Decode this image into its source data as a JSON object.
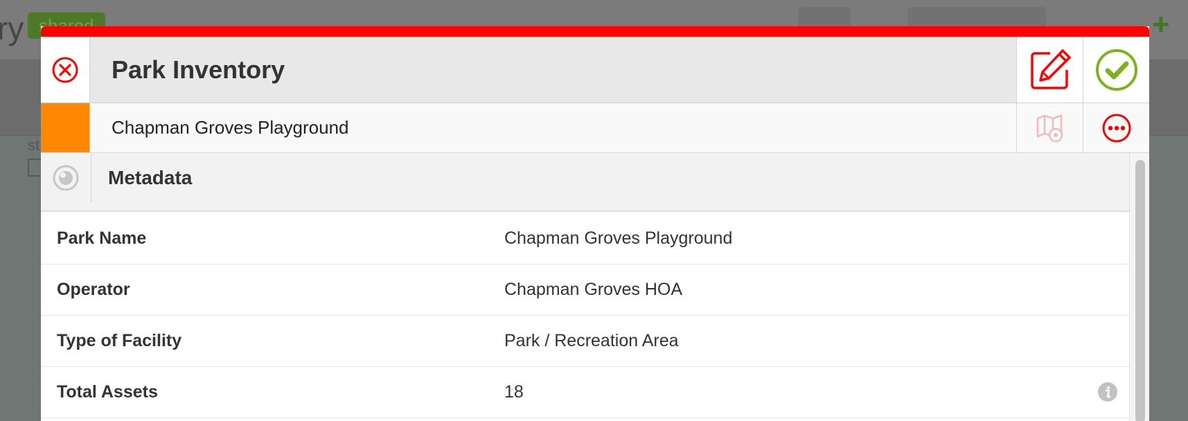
{
  "background_app": {
    "title_fragment": "ry",
    "badge": "shared",
    "sub_label_fragment": "st"
  },
  "modal": {
    "title": "Park Inventory",
    "record_name": "Chapman Groves Playground",
    "record_color": "#ff8800",
    "accent_color": "#ff0000",
    "confirm_color": "#7bb31a",
    "section": {
      "title": "Metadata"
    },
    "fields": [
      {
        "label": "Park Name",
        "value": "Chapman Groves Playground"
      },
      {
        "label": "Operator",
        "value": "Chapman Groves HOA"
      },
      {
        "label": "Type of Facility",
        "value": "Park / Recreation Area"
      },
      {
        "label": "Total Assets",
        "value": "18",
        "has_info": true
      }
    ],
    "icons": {
      "close": "close-circle-icon",
      "edit": "edit-pencil-icon",
      "confirm": "check-circle-icon",
      "map": "map-view-icon",
      "more": "more-dots-icon",
      "section": "eye-icon",
      "info": "info-icon"
    }
  }
}
